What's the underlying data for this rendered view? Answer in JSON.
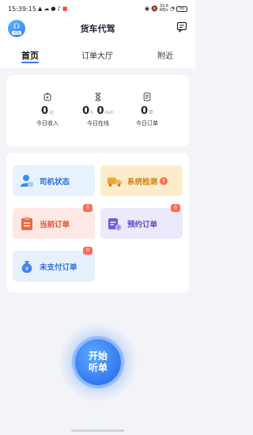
{
  "status_bar": {
    "time": "15:39:15",
    "speed_value": "33.6",
    "speed_unit": "KB/s",
    "battery": "50"
  },
  "header": {
    "title": "货车代驾",
    "logo_text": "代驾"
  },
  "tabs": [
    {
      "label": "首页",
      "active": true
    },
    {
      "label": "订单大厅",
      "active": false
    },
    {
      "label": "附近",
      "active": false
    }
  ],
  "stats": {
    "income": {
      "value": "0",
      "unit": "元",
      "label": "今日收入"
    },
    "online": {
      "hours": "0",
      "hours_unit": "h",
      "minutes": "0",
      "minutes_unit": "min",
      "label": "今日在线"
    },
    "orders": {
      "value": "0",
      "unit": "单",
      "label": "今日订单"
    }
  },
  "menu": {
    "driver_status": {
      "label": "司机状态"
    },
    "system_check": {
      "label": "系统检测",
      "alert": "!"
    },
    "current_orders": {
      "label": "当前订单",
      "badge": "0"
    },
    "reserved_orders": {
      "label": "预约订单",
      "badge": "0"
    },
    "unpaid_orders": {
      "label": "未支付订单",
      "badge": "0"
    }
  },
  "start_button": {
    "line1": "开始",
    "line2": "听单"
  },
  "colors": {
    "accent": "#2f7ef5",
    "driver_bg": "#e8f2fe",
    "system_bg": "#fdeccb",
    "current_bg": "#fde8e4",
    "reserved_bg": "#ece9fb",
    "unpaid_bg": "#e7f1fe",
    "badge": "#ff6b55"
  }
}
